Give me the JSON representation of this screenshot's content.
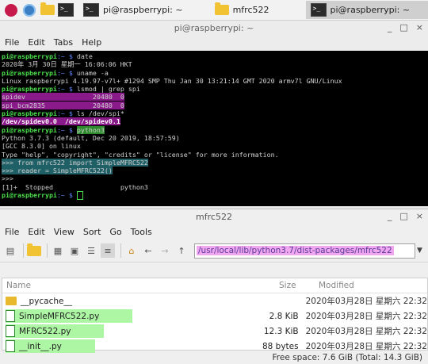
{
  "taskbar": {
    "tasks": [
      {
        "label": "pi@raspberrypi: ~",
        "icon": "terminal-icon"
      },
      {
        "label": "mfrc522",
        "icon": "folder-icon"
      },
      {
        "label": "pi@raspberrypi: ~",
        "icon": "terminal-icon"
      }
    ]
  },
  "terminal_window": {
    "title": "pi@raspberrypi: ~",
    "controls": [
      "_",
      "□",
      "×"
    ],
    "menu": [
      "File",
      "Edit",
      "Tabs",
      "Help"
    ],
    "lines": [
      {
        "prompt": "pi@raspberrypi",
        "path": ":~ $ ",
        "cmd": "date"
      },
      {
        "text": "2020年 3月 30日 星期一 16:06:06 HKT"
      },
      {
        "prompt": "pi@raspberrypi",
        "path": ":~ $ ",
        "cmd": "uname -a"
      },
      {
        "text": "Linux raspberrypi 4.19.97-v7l+ #1294 SMP Thu Jan 30 13:21:14 GMT 2020 armv7l GNU/Linux"
      },
      {
        "prompt": "pi@raspberrypi",
        "path": ":~ $ ",
        "cmd": "lsmod | grep spi"
      },
      {
        "text": "spidev                 20480  0",
        "hl": "mag"
      },
      {
        "text": "spi_bcm2835            20480  0",
        "hl": "mag"
      },
      {
        "prompt": "pi@raspberrypi",
        "path": ":~ $ ",
        "cmd": "ls /dev/spi*"
      },
      {
        "text": "/dev/spidev0.0  /dev/spidev0.1",
        "hl": "mag",
        "bold": true
      },
      {
        "prompt": "pi@raspberrypi",
        "path": ":~ $ ",
        "cmd": "python3",
        "cmdhl": "green"
      },
      {
        "text": "Python 3.7.3 (default, Dec 20 2019, 18:57:59)"
      },
      {
        "text": "[GCC 8.3.0] on linux"
      },
      {
        "text": "Type \"help\", \"copyright\", \"credits\" or \"license\" for more information."
      },
      {
        "text": ">>> from mfrc522 import SimpleMFRC522",
        "hl": "teal"
      },
      {
        "text": ">>> reader = SimpleMFRC522()",
        "hl": "teal"
      },
      {
        "text": ">>>"
      },
      {
        "text": "[1]+  Stopped                 python3"
      },
      {
        "prompt": "pi@raspberrypi",
        "path": ":~ $ ",
        "cmd": "",
        "cursor": true
      }
    ]
  },
  "file_manager": {
    "title": "mfrc522",
    "controls": [
      "_",
      "□",
      "×"
    ],
    "menu": [
      "File",
      "Edit",
      "View",
      "Sort",
      "Go",
      "Tools"
    ],
    "path": "/usr/local/lib/python3.7/dist-packages/mfrc522",
    "columns": {
      "name": "Name",
      "size": "Size",
      "modified": "Modified"
    },
    "rows": [
      {
        "name": "__pycache__",
        "size": "",
        "modified": "2020年03月28日 星期六 22:32",
        "type": "folder",
        "hl": false
      },
      {
        "name": "SimpleMFRC522.py",
        "size": "2.8 KiB",
        "modified": "2020年03月28日 星期六 22:32",
        "type": "file",
        "hl": true
      },
      {
        "name": "MFRC522.py",
        "size": "12.3 KiB",
        "modified": "2020年03月28日 星期六 22:32",
        "type": "file",
        "hl": true
      },
      {
        "name": "__init__.py",
        "size": "88 bytes",
        "modified": "2020年03月28日 星期六 22:32",
        "type": "file",
        "hl": true
      }
    ],
    "status": "Free space: 7.6 GiB (Total: 14.3 GiB)"
  }
}
